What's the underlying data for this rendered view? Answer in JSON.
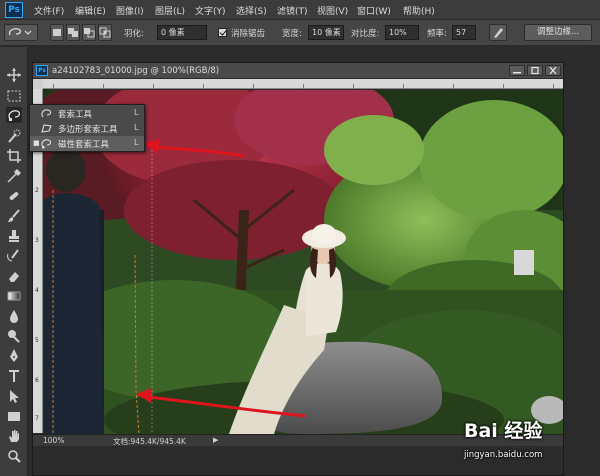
{
  "app": {
    "logo": "Ps"
  },
  "menu": [
    "文件(F)",
    "编辑(E)",
    "图像(I)",
    "图层(L)",
    "文字(Y)",
    "选择(S)",
    "滤镜(T)",
    "视图(V)",
    "窗口(W)",
    "帮助(H)"
  ],
  "options": {
    "feather_label": "羽化:",
    "feather_value": "0 像素",
    "antialias_label": "消除锯齿",
    "antialias_checked": true,
    "width_label": "宽度:",
    "width_value": "10 像素",
    "contrast_label": "对比度:",
    "contrast_value": "10%",
    "frequency_label": "频率:",
    "frequency_value": "57",
    "refine_edge": "调整边缘..."
  },
  "document": {
    "title": "a24102783_01000.jpg @ 100%(RGB/8)",
    "ruler_left_numbers": [
      "1",
      "2",
      "3",
      "4",
      "5",
      "6",
      "7"
    ],
    "status_zoom": "100%",
    "status_doc": "文档:945.4K/945.4K"
  },
  "flyout": {
    "items": [
      {
        "label": "套索工具",
        "key": "L",
        "icon": "lasso-icon",
        "selected": false
      },
      {
        "label": "多边形套索工具",
        "key": "L",
        "icon": "polygonal-lasso-icon",
        "selected": false
      },
      {
        "label": "磁性套索工具",
        "key": "L",
        "icon": "magnetic-lasso-icon",
        "selected": true
      }
    ]
  },
  "watermark": {
    "logo": "Bai 经验",
    "url": "jingyan.baidu.com"
  },
  "colors": {
    "accent": "#31a8ff",
    "annotation_arrow": "#e0141e",
    "marching_ants": "#c87a3a"
  }
}
